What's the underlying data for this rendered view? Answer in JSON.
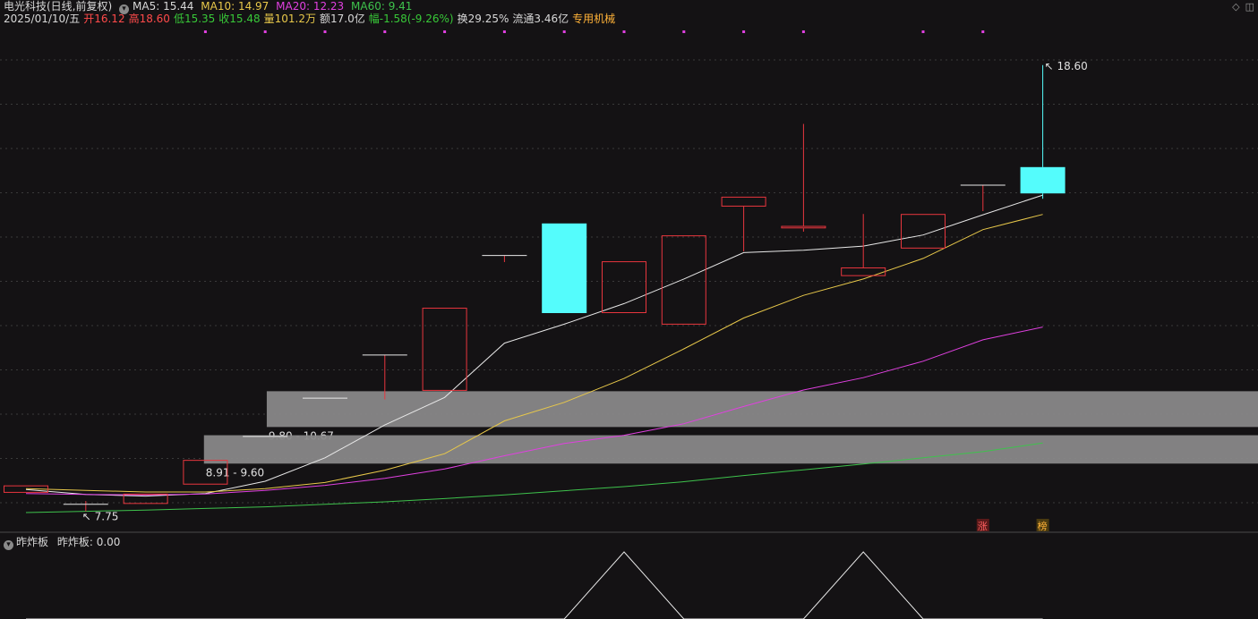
{
  "header": {
    "stock": "电光科技(日线,前复权)",
    "ma5": "MA5: 15.44",
    "ma10": "MA10: 14.97",
    "ma20": "MA20: 12.23",
    "ma60": "MA60: 9.41",
    "date": "2025/01/10/五",
    "open": "开16.12",
    "high": "高18.60",
    "low": "低15.35",
    "close": "收15.48",
    "volume": "量101.2万",
    "amount": "额17.0亿",
    "change": "幅-1.58(-9.26%)",
    "turnover": "换29.25%",
    "float_cap": "流通3.46亿",
    "sector": "专用机械"
  },
  "indicator": {
    "name": "昨炸板",
    "value_label": "昨炸板: 0.00"
  },
  "chart_data": {
    "type": "candlestick",
    "series": [
      {
        "name": "K",
        "candles": [
          {
            "o": 8.2,
            "h": 8.38,
            "l": 8.2,
            "c": 8.38
          },
          {
            "o": 7.92,
            "h": 8.0,
            "l": 7.75,
            "c": 7.92
          },
          {
            "o": 7.93,
            "h": 8.18,
            "l": 7.93,
            "c": 8.18
          },
          {
            "o": 8.4,
            "h": 9.0,
            "l": 8.4,
            "c": 9.0
          },
          {
            "o": 9.57,
            "h": 9.57,
            "l": 9.57,
            "c": 9.57
          },
          {
            "o": 10.5,
            "h": 10.5,
            "l": 10.5,
            "c": 10.5
          },
          {
            "o": 11.55,
            "h": 11.55,
            "l": 10.47,
            "c": 11.55
          },
          {
            "o": 10.68,
            "h": 12.7,
            "l": 10.68,
            "c": 12.7
          },
          {
            "o": 13.97,
            "h": 13.97,
            "l": 13.81,
            "c": 13.97
          },
          {
            "o": 14.75,
            "h": 14.75,
            "l": 12.57,
            "c": 12.57
          },
          {
            "o": 12.57,
            "h": 13.82,
            "l": 12.57,
            "c": 13.83
          },
          {
            "o": 12.29,
            "h": 14.46,
            "l": 12.29,
            "c": 14.46
          },
          {
            "o": 15.16,
            "h": 15.16,
            "l": 14.07,
            "c": 15.4
          },
          {
            "o": 14.63,
            "h": 17.17,
            "l": 14.55,
            "c": 14.69
          },
          {
            "o": 13.47,
            "h": 14.98,
            "l": 13.47,
            "c": 13.68
          },
          {
            "o": 14.14,
            "h": 14.98,
            "l": 14.14,
            "c": 14.98
          },
          {
            "o": 15.68,
            "h": 15.68,
            "l": 15.05,
            "c": 15.68
          },
          {
            "o": 16.12,
            "h": 18.6,
            "l": 15.35,
            "c": 15.48
          }
        ]
      },
      {
        "name": "MA5",
        "color": "#e8e8e8",
        "values": [
          8.28,
          8.16,
          8.12,
          8.18,
          8.48,
          9.05,
          9.85,
          10.52,
          11.84,
          12.3,
          12.8,
          13.4,
          14.04,
          14.1,
          14.2,
          14.47,
          14.96,
          15.44
        ]
      },
      {
        "name": "MA10",
        "color": "#e8c84a",
        "values": [
          8.3,
          8.26,
          8.22,
          8.22,
          8.3,
          8.45,
          8.75,
          9.15,
          9.95,
          10.4,
          10.98,
          11.7,
          12.45,
          13.0,
          13.4,
          13.9,
          14.6,
          14.97
        ]
      },
      {
        "name": "MA20",
        "color": "#e040e0",
        "values": [
          8.18,
          8.16,
          8.15,
          8.17,
          8.26,
          8.38,
          8.55,
          8.78,
          9.1,
          9.4,
          9.6,
          9.88,
          10.3,
          10.7,
          11.0,
          11.4,
          11.92,
          12.23
        ]
      },
      {
        "name": "MA60",
        "color": "#3ec24c",
        "values": [
          7.72,
          7.75,
          7.78,
          7.82,
          7.86,
          7.92,
          7.98,
          8.06,
          8.15,
          8.25,
          8.35,
          8.47,
          8.62,
          8.76,
          8.9,
          9.05,
          9.2,
          9.41
        ]
      }
    ],
    "zones": [
      {
        "label": "9.80 - 10.67",
        "low": 9.8,
        "high": 10.67
      },
      {
        "label": "8.91 - 9.60",
        "low": 8.91,
        "high": 9.6
      }
    ],
    "annotations": [
      {
        "label": "18.60",
        "type": "high-marker"
      },
      {
        "label": "7.75",
        "type": "low-marker"
      },
      {
        "label": "涨",
        "type": "tag"
      },
      {
        "label": "榜",
        "type": "tag"
      }
    ],
    "ylim": [
      7.35,
      19.4
    ],
    "grid": true,
    "subchart": {
      "name": "昨炸板",
      "values": [
        0,
        0,
        0,
        0,
        0,
        0,
        0,
        0,
        0,
        0,
        1,
        0,
        0,
        0,
        1,
        0,
        0,
        0
      ]
    }
  },
  "colors": {
    "up": "#e8363e",
    "down": "#54fcfc",
    "zone": "#888888",
    "bg": "#141214"
  }
}
